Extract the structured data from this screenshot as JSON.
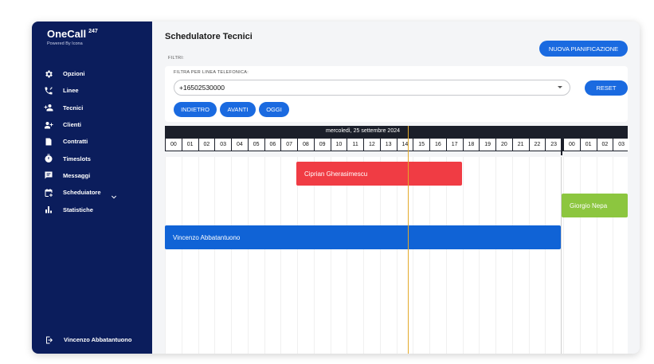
{
  "app": {
    "name": "OneCall",
    "superscript": "247",
    "tagline": "Powered By Icona"
  },
  "sidebar": {
    "items": [
      {
        "label": "Opzioni",
        "icon": "gear-icon"
      },
      {
        "label": "Linee",
        "icon": "phone-icon"
      },
      {
        "label": "Tecnici",
        "icon": "person-add-icon"
      },
      {
        "label": "Clienti",
        "icon": "group-add-icon"
      },
      {
        "label": "Contratti",
        "icon": "document-icon"
      },
      {
        "label": "Timeslots",
        "icon": "stopwatch-icon"
      },
      {
        "label": "Messaggi",
        "icon": "message-icon"
      },
      {
        "label": "Scheduiatore",
        "icon": "calendar-icon"
      },
      {
        "label": "Statistiche",
        "icon": "bar-chart-icon"
      }
    ],
    "user": {
      "name": "Vincenzo Abbatantuono",
      "icon": "logout-icon"
    }
  },
  "header": {
    "title": "Schedulatore Tecnici",
    "new_button": "NUOVA PIANIFICAZIONE"
  },
  "filters": {
    "section_label": "FILTRI:",
    "phone_label": "FILTRA PER LINEA TELEFONICA:",
    "phone_value": "+16502530000",
    "reset_label": "RESET",
    "back_label": "INDIETRO",
    "forward_label": "AVANTI",
    "today_label": "OGGI"
  },
  "timeline": {
    "date": "mercoledì, 25 settembre 2024",
    "hours": [
      "00",
      "01",
      "02",
      "03",
      "04",
      "05",
      "06",
      "07",
      "08",
      "09",
      "10",
      "11",
      "12",
      "13",
      "14",
      "15",
      "16",
      "17",
      "18",
      "19",
      "20",
      "21",
      "22",
      "23",
      "00",
      "01",
      "02",
      "03"
    ],
    "bookings": [
      {
        "name": "Ciprian Gherasimescu",
        "color": "#f03c44"
      },
      {
        "name": "Giorgio Nepa",
        "color": "#8cc63f"
      },
      {
        "name": "Vincenzo Abbatantuono",
        "color": "#1063d6"
      }
    ]
  },
  "colors": {
    "sidebar": "#0b1d5c",
    "accent": "#1a6ae0",
    "now_line": "#e3a92a"
  }
}
